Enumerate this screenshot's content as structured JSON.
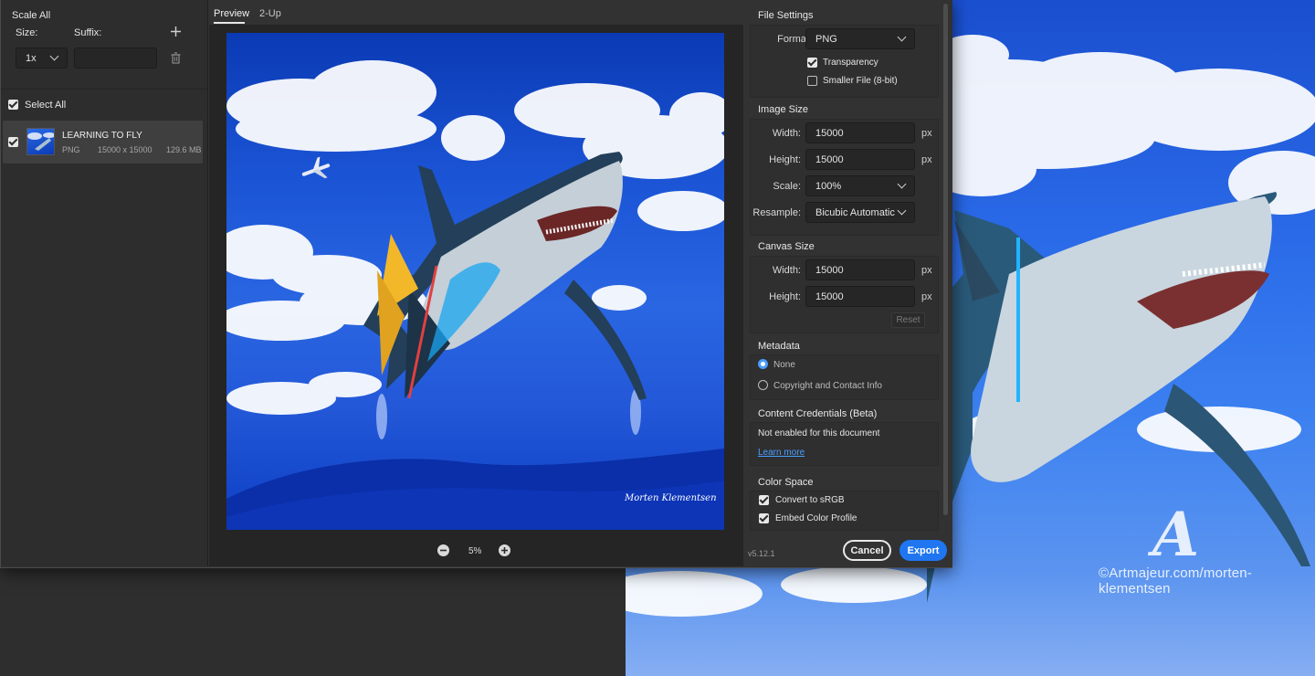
{
  "left": {
    "scale_all": "Scale All",
    "size_label": "Size:",
    "suffix_label": "Suffix:",
    "size_value": "1x",
    "suffix_value": "",
    "select_all": "Select All",
    "asset": {
      "name": "LEARNING TO FLY",
      "format": "PNG",
      "dimensions": "15000 x 15000",
      "filesize": "129.6 MB"
    }
  },
  "preview": {
    "tab_preview": "Preview",
    "tab_2up": "2-Up",
    "zoom": "5%",
    "signature": "Morten Klementsen"
  },
  "right": {
    "file_settings": "File Settings",
    "format_label": "Format:",
    "format_value": "PNG",
    "transparency": "Transparency",
    "smaller_file": "Smaller File (8-bit)",
    "image_size": "Image Size",
    "width_label": "Width:",
    "height_label": "Height:",
    "width_value": "15000",
    "height_value": "15000",
    "unit": "px",
    "scale_label": "Scale:",
    "scale_value": "100%",
    "resample_label": "Resample:",
    "resample_value": "Bicubic Automatic",
    "canvas_size": "Canvas Size",
    "canvas_width_value": "15000",
    "canvas_height_value": "15000",
    "reset": "Reset",
    "metadata": "Metadata",
    "meta_none": "None",
    "meta_copyright": "Copyright and Contact Info",
    "content_credentials": "Content Credentials (Beta)",
    "not_enabled": "Not enabled for this document",
    "learn_more": "Learn more",
    "color_space": "Color Space",
    "convert_srgb": "Convert to sRGB",
    "embed_profile": "Embed Color Profile",
    "version": "v5.12.1",
    "cancel": "Cancel",
    "export": "Export"
  },
  "watermark": {
    "logo_letter": "A",
    "credit": "©Artmajeur.com/morten-klementsen"
  },
  "colors": {
    "accent": "#1f76f0",
    "radio_on": "#4b9cff",
    "sky": "#2a66e2"
  }
}
